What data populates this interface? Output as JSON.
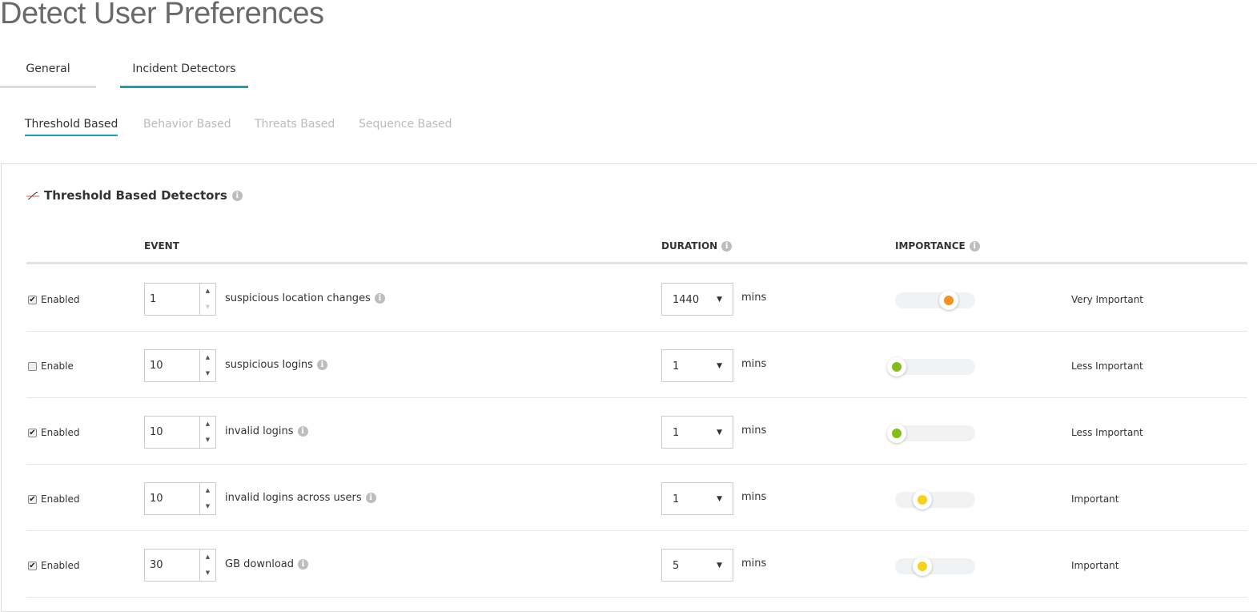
{
  "title": "Detect User Preferences",
  "tabs": [
    "General",
    "Incident Detectors"
  ],
  "subtabs": [
    "Threshold Based",
    "Behavior Based",
    "Threats Based",
    "Sequence Based"
  ],
  "panel_title": "Threshold Based Detectors",
  "headers": {
    "event": "EVENT",
    "duration": "DURATION",
    "importance": "IMPORTANCE"
  },
  "units": "mins",
  "rows": [
    {
      "checked": true,
      "check_label": "Enabled",
      "count": "1",
      "event": "suspicious location changes",
      "duration": "1440",
      "importance": "Very Important",
      "level": 0.67,
      "color": "#f39220"
    },
    {
      "checked": false,
      "check_label": "Enable",
      "count": "10",
      "event": "suspicious logins",
      "duration": "1",
      "importance": "Less Important",
      "level": 0.02,
      "color": "#84bd1a"
    },
    {
      "checked": true,
      "check_label": "Enabled",
      "count": "10",
      "event": "invalid logins",
      "duration": "1",
      "importance": "Less Important",
      "level": 0.02,
      "color": "#84bd1a"
    },
    {
      "checked": true,
      "check_label": "Enabled",
      "count": "10",
      "event": "invalid logins across users",
      "duration": "1",
      "importance": "Important",
      "level": 0.34,
      "color": "#f7d21c"
    },
    {
      "checked": true,
      "check_label": "Enabled",
      "count": "30",
      "event": "GB download",
      "duration": "5",
      "importance": "Important",
      "level": 0.34,
      "color": "#f7d21c"
    }
  ]
}
